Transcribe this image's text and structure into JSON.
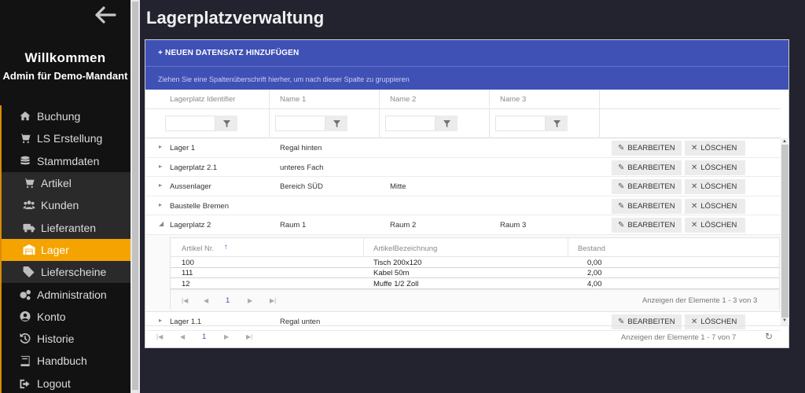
{
  "sidebar": {
    "welcome": "Willkommen",
    "user": "Admin für Demo-Mandant",
    "items": [
      {
        "label": "Buchung",
        "icon": "home-icon",
        "sub": false,
        "active": false
      },
      {
        "label": "LS Erstellung",
        "icon": "cart-plus-icon",
        "sub": false,
        "active": false
      },
      {
        "label": "Stammdaten",
        "icon": "database-icon",
        "sub": false,
        "active": false
      },
      {
        "label": "Artikel",
        "icon": "cart-icon",
        "sub": true,
        "active": false
      },
      {
        "label": "Kunden",
        "icon": "users-icon",
        "sub": true,
        "active": false
      },
      {
        "label": "Lieferanten",
        "icon": "truck-icon",
        "sub": true,
        "active": false
      },
      {
        "label": "Lager",
        "icon": "warehouse-icon",
        "sub": true,
        "active": true
      },
      {
        "label": "Lieferscheine",
        "icon": "tag-icon",
        "sub": true,
        "active": false
      },
      {
        "label": "Administration",
        "icon": "cogs-icon",
        "sub": false,
        "active": false
      },
      {
        "label": "Konto",
        "icon": "user-circle-icon",
        "sub": false,
        "active": false
      },
      {
        "label": "Historie",
        "icon": "history-icon",
        "sub": false,
        "active": false
      },
      {
        "label": "Handbuch",
        "icon": "book-icon",
        "sub": false,
        "active": false
      },
      {
        "label": "Logout",
        "icon": "logout-icon",
        "sub": false,
        "active": false
      }
    ]
  },
  "page": {
    "title": "Lagerplatzverwaltung"
  },
  "grid": {
    "add_label": "+ NEUEN DATENSATZ HINZUFÜGEN",
    "group_hint": "Ziehen Sie eine Spaltenüberschrift hierher, um nach dieser Spalte zu gruppieren",
    "columns": [
      "Lagerplatz Identifier",
      "Name 1",
      "Name 2",
      "Name 3"
    ],
    "edit_label": "BEARBEITEN",
    "delete_label": "LÖSCHEN",
    "rows": [
      {
        "id": "Lager 1",
        "name1": "Regal hinten",
        "name2": "",
        "name3": "",
        "expanded": false
      },
      {
        "id": "Lagerplatz 2.1",
        "name1": "unteres Fach",
        "name2": "",
        "name3": "",
        "expanded": false
      },
      {
        "id": "Aussenlager",
        "name1": "Bereich SÜD",
        "name2": "Mitte",
        "name3": "",
        "expanded": false
      },
      {
        "id": "Baustelle Bremen",
        "name1": "",
        "name2": "",
        "name3": "",
        "expanded": false
      },
      {
        "id": "Lagerplatz 2",
        "name1": "Raum 1",
        "name2": "Raum 2",
        "name3": "Raum 3",
        "expanded": true
      }
    ],
    "last_row": {
      "id": "Lager 1.1",
      "name1": "Regal unten",
      "name2": "",
      "name3": ""
    },
    "detail": {
      "columns": [
        "Artikel Nr.",
        "ArtikelBezeichnung",
        "Bestand"
      ],
      "rows": [
        {
          "nr": "100",
          "bez": "Tisch 200x120",
          "bestand": "0,00"
        },
        {
          "nr": "111",
          "bez": "Kabel 50m",
          "bestand": "2,00"
        },
        {
          "nr": "12",
          "bez": "Muffe 1/2 Zoll",
          "bestand": "4,00"
        }
      ],
      "page": "1",
      "info": "Anzeigen der Elemente 1 - 3 von 3"
    },
    "pager": {
      "page": "1",
      "info": "Anzeigen der Elemente 1 - 7 von 7"
    }
  }
}
